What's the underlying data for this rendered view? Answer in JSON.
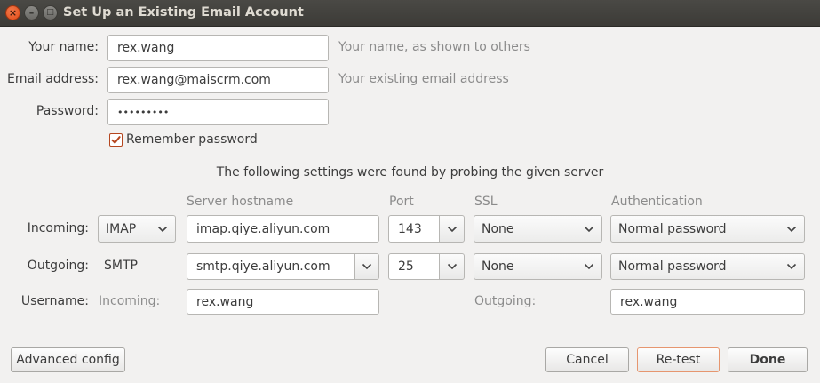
{
  "window": {
    "title": "Set Up an Existing Email Account"
  },
  "account": {
    "name_label": "Your name:",
    "name_value": "rex.wang",
    "name_hint": "Your name, as shown to others",
    "email_label": "Email address:",
    "email_value": "rex.wang@maiscrm.com",
    "email_hint": "Your existing email address",
    "password_label": "Password:",
    "password_value": "•••••••••",
    "remember_label": "Remember password",
    "remember_checked": true
  },
  "probe_message": "The following settings were found by probing the given server",
  "columns": {
    "hostname": "Server hostname",
    "port": "Port",
    "ssl": "SSL",
    "auth": "Authentication"
  },
  "incoming": {
    "label": "Incoming:",
    "protocol": "IMAP",
    "hostname": "imap.qiye.aliyun.com",
    "port": "143",
    "ssl": "None",
    "auth": "Normal password"
  },
  "outgoing": {
    "label": "Outgoing:",
    "protocol": "SMTP",
    "hostname": "smtp.qiye.aliyun.com",
    "port": "25",
    "ssl": "None",
    "auth": "Normal password"
  },
  "username": {
    "label": "Username:",
    "incoming_label": "Incoming:",
    "incoming_value": "rex.wang",
    "outgoing_label": "Outgoing:",
    "outgoing_value": "rex.wang"
  },
  "buttons": {
    "advanced": "Advanced config",
    "cancel": "Cancel",
    "retest": "Re-test",
    "done": "Done"
  },
  "colors": {
    "titlebar": "#3c3b37",
    "close_button": "#df4a16",
    "checkbox_accent": "#b5461f"
  }
}
